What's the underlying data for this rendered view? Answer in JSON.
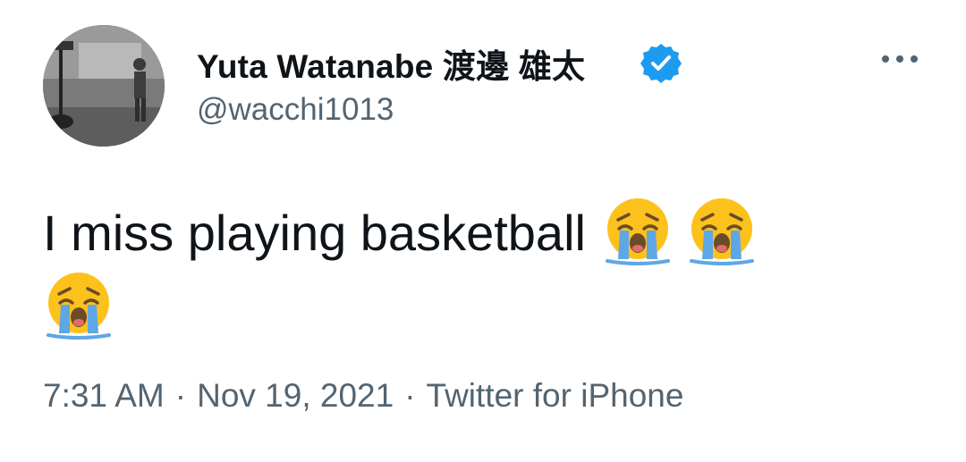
{
  "author": {
    "display_name": "Yuta Watanabe 渡邊 雄太",
    "handle": "@wacchi1013",
    "verified": true,
    "verified_color": "#1d9bf0"
  },
  "actions": {
    "more_icon": "more-horizontal-icon"
  },
  "tweet": {
    "text": "I miss playing basketball",
    "emoji_name": "loudly-crying-face-emoji",
    "emoji_count": 3
  },
  "meta": {
    "time": "7:31 AM",
    "separator": "·",
    "date": "Nov 19, 2021",
    "source": "Twitter for iPhone"
  },
  "colors": {
    "text_primary": "#0f1419",
    "text_secondary": "#536471"
  }
}
